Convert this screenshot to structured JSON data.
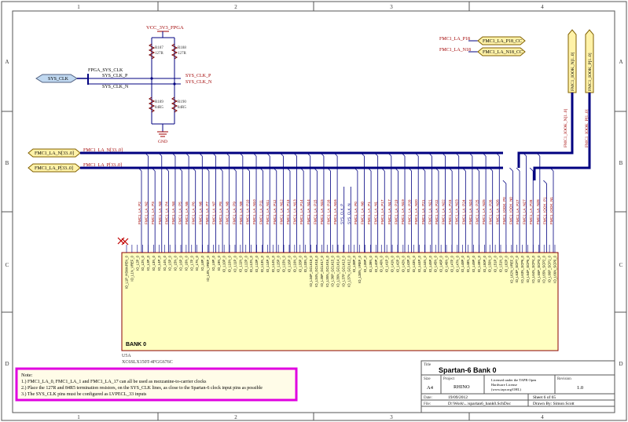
{
  "frame": {
    "columns": [
      "1",
      "2",
      "3",
      "4"
    ],
    "rows": [
      "A",
      "B",
      "C",
      "D"
    ]
  },
  "clock": {
    "vcc_net": "VCC_3V3_FPGA",
    "gnd_label": "GND",
    "fpga_sys_clk": "FPGA_SYS_CLK",
    "sys_clk_port": "SYS_CLK",
    "net_p": "SYS_CLK_P",
    "net_n": "SYS_CLK_N",
    "resistors": [
      {
        "ref": "R187",
        "val": "127R"
      },
      {
        "ref": "R188",
        "val": "127R"
      },
      {
        "ref": "R189",
        "val": "84R5"
      },
      {
        "ref": "R190",
        "val": "84R5"
      }
    ]
  },
  "ports": {
    "la_n_port": "FMC1_LA_N[33..0]",
    "la_p_port": "FMC1_LA_P[33..0]",
    "la_n_bus": "FMC1_LA_N[33..0]",
    "la_p_bus": "FMC1_LA_P[33..0]",
    "p18_net": "FMC1_LA_P18",
    "p18_port": "FMC1_LA_P18_CC",
    "n18_net": "FMC1_LA_N18",
    "n18_port": "FMC1_LA_N18_CC",
    "iook_n_port": "FMC1_IOOK_N[1..0]",
    "iook_p_port": "FMC1_IOOK_P[1..0]",
    "iook_n_bus": "FMC1_IOOK_N[1..0]",
    "iook_p_bus": "FMC1_IOOK_P[1..0]"
  },
  "bank": {
    "label": "BANK 0",
    "designator": "U5A",
    "part": "XC6SLX150T-4FGG676C",
    "nets": [
      "FMC1_LA_P2",
      "FMC1_LA_N2",
      "FMC1_LA_P3",
      "FMC1_LA_N3",
      "FMC1_LA_P4",
      "FMC1_LA_N4",
      "FMC1_LA_P5",
      "FMC1_LA_N5",
      "FMC1_LA_P6",
      "FMC1_LA_N6",
      "FMC1_LA_P7",
      "FMC1_LA_N7",
      "FMC1_LA_P8",
      "FMC1_LA_N8",
      "FMC1_LA_P9",
      "FMC1_LA_N9",
      "FMC1_LA_P10",
      "FMC1_LA_N10",
      "FMC1_LA_P11",
      "FMC1_LA_N11",
      "FMC1_LA_P12",
      "FMC1_LA_N12",
      "FMC1_LA_P13",
      "FMC1_LA_N13",
      "FMC1_LA_P14",
      "FMC1_LA_N14",
      "FMC1_LA_P15",
      "FMC1_LA_N15",
      "FMC1_LA_P16",
      "FMC1_LA_N16",
      "SYS_CLK_P",
      "SYS_CLK_N",
      "FMC1_LA_P0",
      "FMC1_LA_N0",
      "FMC1_LA_P1",
      "FMC1_LA_N1",
      "FMC1_LA_P17",
      "FMC1_LA_N17",
      "FMC1_LA_P19",
      "FMC1_LA_N19",
      "FMC1_LA_P20",
      "FMC1_LA_N20",
      "FMC1_LA_P21",
      "FMC1_LA_N21",
      "FMC1_LA_P22",
      "FMC1_LA_N22",
      "FMC1_LA_P23",
      "FMC1_LA_N23",
      "FMC1_LA_P24",
      "FMC1_LA_N24",
      "FMC1_LA_P25",
      "FMC1_LA_N25",
      "FMC1_LA_P26",
      "FMC1_LA_N26",
      "FMC1_IOOK_P0",
      "FMC1_IOOK_N0",
      "FMC1_LA_P27",
      "FMC1_LA_N27",
      "FMC1_LA_P28",
      "FMC1_LA_N28",
      "FMC1_IOOK_P1",
      "FMC1_IOOK_N1"
    ],
    "pins": [
      "IO_L1P_HSWAPEN_0",
      "IO_L1N_VREF_0",
      "IO_L2P_0",
      "IO_L2N_0",
      "IO_L3P_0",
      "IO_L3N_0",
      "IO_L4P_0",
      "IO_L4N_0",
      "IO_L5P_0",
      "IO_L5N_0",
      "IO_L6P_0",
      "IO_L6N_0",
      "IO_L7P_0",
      "IO_L7N_0",
      "IO_L8P_0",
      "IO_L8N_VREF_0",
      "IO_L9P_0",
      "IO_L9N_0",
      "IO_L10P_0",
      "IO_L10N_0",
      "IO_L11P_0",
      "IO_L11N_0",
      "IO_L12P_0",
      "IO_L12N_0",
      "IO_L13P_0",
      "IO_L13N_0",
      "IO_L14P_0",
      "IO_L14N_0",
      "IO_L15P_0",
      "IO_L15N_0",
      "IO_L16P_0",
      "IO_L16N_0",
      "IO_L33P_0",
      "IO_L33N_0",
      "IO_L34P_GCLK19_0",
      "IO_L34N_GCLK18_0",
      "IO_L35P_GCLK17_0",
      "IO_L35N_GCLK16_0",
      "IO_L36P_GCLK15_0",
      "IO_L36N_GCLK14_0",
      "IO_L37P_GCLK13_0",
      "IO_L37N_GCLK12_0",
      "IO_L38P_0",
      "IO_L38N_VREF_0",
      "IO_L39P_0",
      "IO_L39N_0",
      "IO_L40P_0",
      "IO_L40N_0",
      "IO_L41P_0",
      "IO_L41N_0",
      "IO_L42P_0",
      "IO_L42N_0",
      "IO_L43P_0",
      "IO_L43N_0",
      "IO_L44P_0",
      "IO_L44N_0",
      "IO_L45P_0",
      "IO_L45N_0",
      "IO_L46P_0",
      "IO_L46N_0",
      "IO_L47P_0",
      "IO_L47N_0",
      "IO_L48P_0",
      "IO_L48N_0",
      "IO_L49P_0",
      "IO_L49N_0",
      "IO_L50P_0",
      "IO_L50N_0",
      "IO_L51P_0",
      "IO_L51N_0",
      "IO_L62P_0",
      "IO_L62N_VREF_0",
      "IO_L63P_SCP7_0",
      "IO_L63N_SCP6_0",
      "IO_L64P_SCP5_0",
      "IO_L64N_SCP4_0",
      "IO_L65P_SCP3_0",
      "IO_L65N_SCP2_0",
      "IO_L66P_SCP1_0",
      "IO_L66N_SCP0_0"
    ]
  },
  "note": {
    "title": "Note:",
    "lines": [
      "1.) FMC1_LA_0, FMC1_LA_1 and FMC1_LA_17 can all be used as mezzanine-to-carrier clocks",
      "2.) Place the 127R and 84R5 termination resistors, on the SYS_CLK lines, as close to the Spartan-6 clock input pins as possible",
      "3.) The SYS_CLK pins must be configured as LVPECL_33 inputs"
    ]
  },
  "title_block": {
    "title_label": "Title",
    "title": "Spartan-6 Bank 0",
    "size_label": "Size",
    "size": "A4",
    "project_label": "Project",
    "project": "RHINO",
    "license": [
      "Licensed under the TAPR Open",
      "Hardware License",
      "(www.tapr.org/OHL)"
    ],
    "revision_label": "Revision",
    "revision": "1.0",
    "date_label": "Date:",
    "date": "19/09/2012",
    "sheet_text": "Sheet   6    of    65",
    "file_label": "File:",
    "file": "D:\\Work\\...\\spartan6_bank0.SchDoc",
    "drawn_by_text": "Drawn By:      Simon Scott"
  }
}
